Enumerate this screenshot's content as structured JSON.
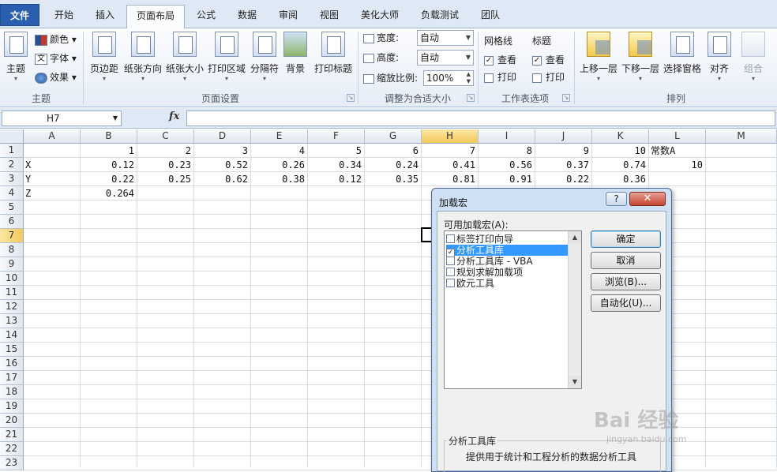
{
  "ribbon_tabs": [
    "文件",
    "开始",
    "插入",
    "页面布局",
    "公式",
    "数据",
    "审阅",
    "视图",
    "美化大师",
    "负载测试",
    "团队"
  ],
  "ribbon": {
    "theme": {
      "big": "主题",
      "colors": "颜色",
      "fonts": "字体",
      "effects": "效果",
      "group": "主题"
    },
    "page_setup": {
      "margins": "页边距",
      "orientation": "纸张方向",
      "size": "纸张大小",
      "print_area": "打印区域",
      "breaks": "分隔符",
      "background": "背景",
      "print_titles": "打印标题",
      "group": "页面设置"
    },
    "scale": {
      "width_label": "宽度:",
      "width_value": "自动",
      "height_label": "高度:",
      "height_value": "自动",
      "scale_label": "缩放比例:",
      "scale_value": "100%",
      "group": "调整为合适大小"
    },
    "sheet_options": {
      "gridlines": "网格线",
      "headings": "标题",
      "view": "查看",
      "print": "打印",
      "group": "工作表选项"
    },
    "arrange": {
      "bring_forward": "上移一层",
      "send_backward": "下移一层",
      "selection_pane": "选择窗格",
      "align": "对齐",
      "group_btn": "组合",
      "group": "排列"
    }
  },
  "formula_bar": {
    "name_box": "H7",
    "fx": "fx",
    "formula": ""
  },
  "columns": [
    "A",
    "B",
    "C",
    "D",
    "E",
    "F",
    "G",
    "H",
    "I",
    "J",
    "K",
    "L",
    "M"
  ],
  "selected_column": "H",
  "rows": [
    "1",
    "2",
    "3",
    "4",
    "5",
    "6",
    "7",
    "8",
    "9",
    "10",
    "11",
    "12",
    "13",
    "14",
    "15",
    "16",
    "17",
    "18",
    "19",
    "20",
    "21",
    "22",
    "23"
  ],
  "selected_row": "7",
  "cells": {
    "r1": [
      "",
      "1",
      "2",
      "3",
      "4",
      "5",
      "6",
      "7",
      "8",
      "9",
      "10",
      "常数A",
      ""
    ],
    "r2": [
      "X",
      "0.12",
      "0.23",
      "0.52",
      "0.26",
      "0.34",
      "0.24",
      "0.41",
      "0.56",
      "0.37",
      "0.74",
      "10",
      ""
    ],
    "r3": [
      "Y",
      "0.22",
      "0.25",
      "0.62",
      "0.38",
      "0.12",
      "0.35",
      "0.81",
      "0.91",
      "0.22",
      "0.36",
      "",
      ""
    ],
    "r4": [
      "Z",
      "0.264",
      "",
      "",
      "",
      "",
      "",
      "",
      "",
      "",
      "",
      "",
      ""
    ]
  },
  "dialog": {
    "title": "加载宏",
    "help": "?",
    "close": "✕",
    "list_label": "可用加载宏(A):",
    "items": [
      {
        "label": "标签打印向导",
        "checked": false
      },
      {
        "label": "分析工具库",
        "checked": true
      },
      {
        "label": "分析工具库 - VBA",
        "checked": false
      },
      {
        "label": "规划求解加载项",
        "checked": false
      },
      {
        "label": "欧元工具",
        "checked": false
      }
    ],
    "buttons": {
      "ok": "确定",
      "cancel": "取消",
      "browse": "浏览(B)...",
      "automation": "自动化(U)..."
    },
    "desc_title": "分析工具库",
    "desc_text": "提供用于统计和工程分析的数据分析工具"
  },
  "watermark": {
    "logo": "Bai 经验",
    "url": "jingyan.baidu.com"
  }
}
